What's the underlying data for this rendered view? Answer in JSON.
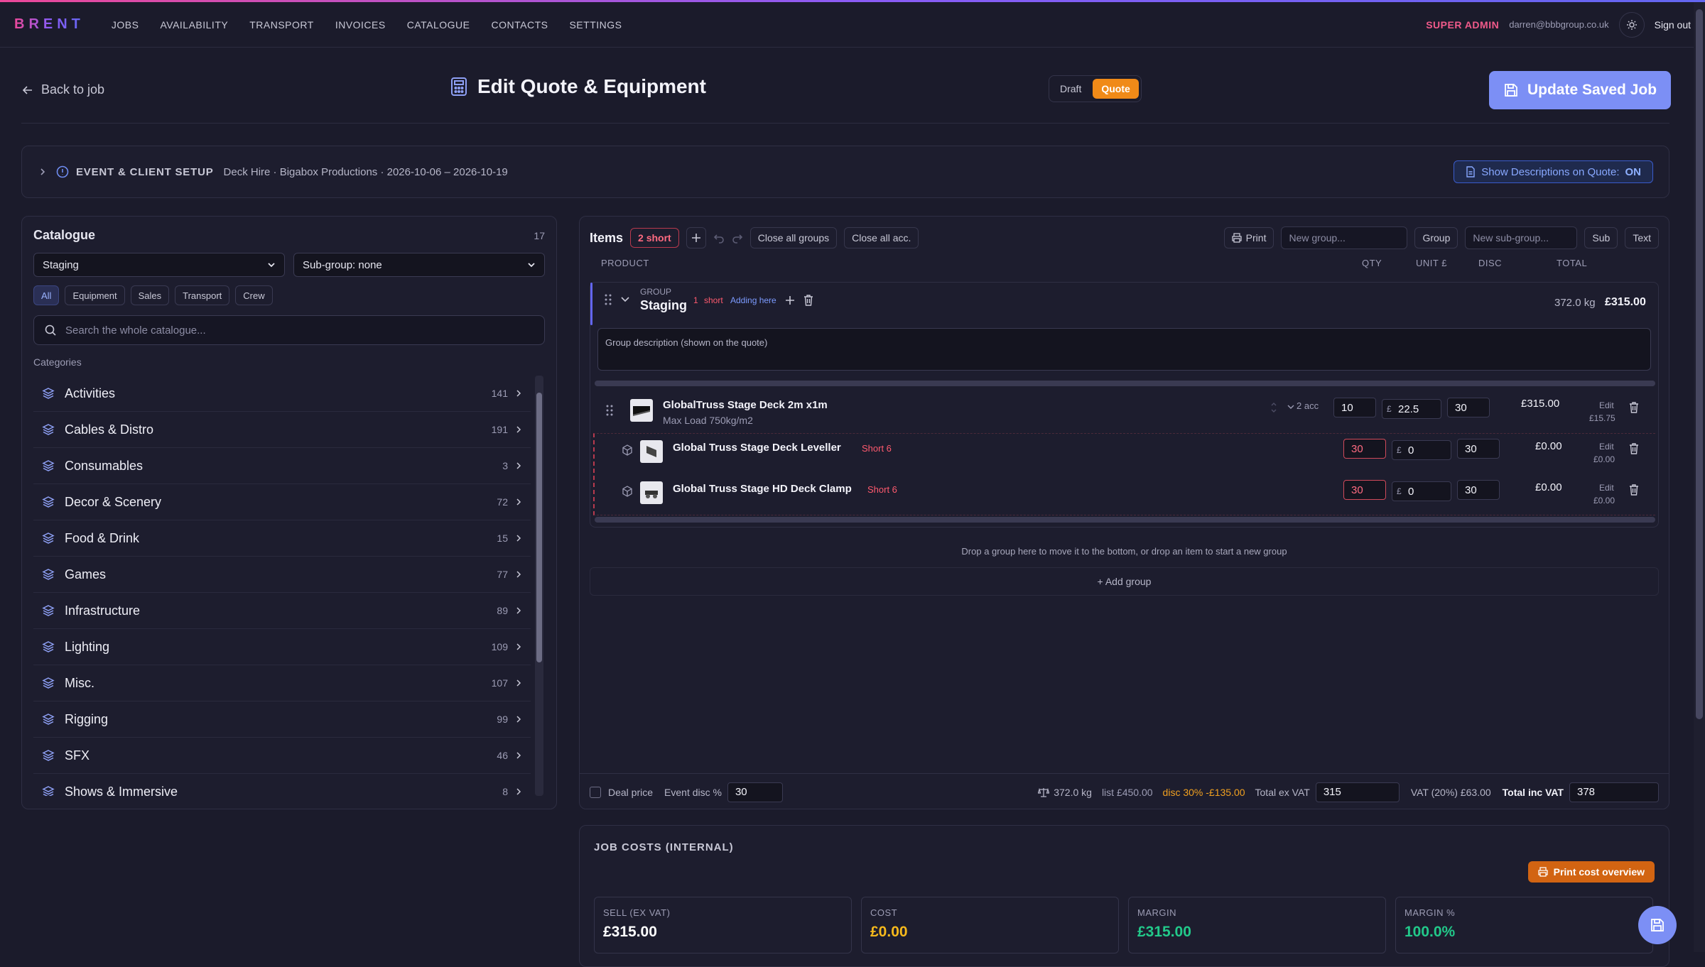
{
  "nav": {
    "brand": "BRENT",
    "links": [
      "JOBS",
      "AVAILABILITY",
      "TRANSPORT",
      "INVOICES",
      "CATALOGUE",
      "CONTACTS",
      "SETTINGS"
    ],
    "role": "SUPER ADMIN",
    "email": "darren@bbbgroup.co.uk",
    "sign_out": "Sign out"
  },
  "header": {
    "back": "Back to job",
    "title": "Edit Quote & Equipment",
    "toggle": [
      "Draft",
      "Quote"
    ],
    "toggle_active": "Quote",
    "update": "Update Saved Job"
  },
  "setup": {
    "label": "EVENT & CLIENT SETUP",
    "summary": "Deck Hire · Bigabox Productions · 2026-10-06 – 2026-10-19",
    "desc_button": "Show Descriptions on Quote:",
    "desc_state": "ON"
  },
  "catalogue": {
    "title": "Catalogue",
    "count": "17",
    "category_select": "Staging",
    "subgroup_select": "Sub-group: none",
    "filters": [
      "All",
      "Equipment",
      "Sales",
      "Transport",
      "Crew"
    ],
    "search_placeholder": "Search the whole catalogue...",
    "categories_label": "Categories",
    "categories": [
      {
        "name": "Activities",
        "count": "141"
      },
      {
        "name": "Cables & Distro",
        "count": "191"
      },
      {
        "name": "Consumables",
        "count": "3"
      },
      {
        "name": "Decor & Scenery",
        "count": "72"
      },
      {
        "name": "Food & Drink",
        "count": "15"
      },
      {
        "name": "Games",
        "count": "77"
      },
      {
        "name": "Infrastructure",
        "count": "89"
      },
      {
        "name": "Lighting",
        "count": "109"
      },
      {
        "name": "Misc.",
        "count": "107"
      },
      {
        "name": "Rigging",
        "count": "99"
      },
      {
        "name": "SFX",
        "count": "46"
      },
      {
        "name": "Shows & Immersive",
        "count": "8"
      }
    ]
  },
  "items": {
    "title": "Items",
    "short_badge": "2 short",
    "close_groups": "Close all groups",
    "close_acc": "Close all acc.",
    "print": "Print",
    "new_group_placeholder": "New group...",
    "group_btn": "Group",
    "new_sub_placeholder": "New sub-group...",
    "sub_btn": "Sub",
    "text_btn": "Text",
    "columns": {
      "product": "PRODUCT",
      "qty": "QTY",
      "unit": "UNIT £",
      "disc": "DISC",
      "total": "TOTAL"
    },
    "group": {
      "label": "GROUP",
      "name": "Staging",
      "short_count": "1",
      "short_word": "short",
      "adding": "Adding here",
      "weight": "372.0 kg",
      "total": "£315.00",
      "desc_placeholder": "Group description (shown on the quote)"
    },
    "lines": [
      {
        "name": "GlobalTruss Stage Deck 2m x1m",
        "sub": "Max Load 750kg/m2",
        "acc": "2 acc",
        "qty": "10",
        "unit": "22.5",
        "disc": "30",
        "total": "£315.00",
        "edit": "Edit",
        "net": "£15.75",
        "short": ""
      },
      {
        "name": "Global Truss Stage Deck Leveller",
        "sub": "",
        "acc": "",
        "qty": "30",
        "unit": "0",
        "disc": "30",
        "total": "£0.00",
        "edit": "Edit",
        "net": "£0.00",
        "short": "Short 6"
      },
      {
        "name": "Global Truss Stage HD Deck Clamp",
        "sub": "",
        "acc": "",
        "qty": "30",
        "unit": "0",
        "disc": "30",
        "total": "£0.00",
        "edit": "Edit",
        "net": "£0.00",
        "short": "Short 6"
      }
    ],
    "currency": "£",
    "drop_note": "Drop a group here to move it to the bottom, or drop an item to start a new group",
    "add_group": "+ Add group",
    "footer": {
      "deal": "Deal price",
      "event_disc_label": "Event disc %",
      "event_disc": "30",
      "weight": "372.0 kg",
      "list": "list £450.00",
      "disc": "disc 30% -£135.00",
      "ex_vat_label": "Total ex VAT",
      "ex_vat": "315",
      "vat": "VAT (20%) £63.00",
      "inc_vat_label": "Total inc VAT",
      "inc_vat": "378"
    }
  },
  "costs": {
    "title": "JOB COSTS (INTERNAL)",
    "print": "Print cost overview",
    "cards": [
      {
        "label": "SELL (EX VAT)",
        "value": "£315.00",
        "color": "#ffffff"
      },
      {
        "label": "COST",
        "value": "£0.00",
        "color": "#f6b91c"
      },
      {
        "label": "MARGIN",
        "value": "£315.00",
        "color": "#22c98a"
      },
      {
        "label": "MARGIN %",
        "value": "100.0%",
        "color": "#22c98a"
      }
    ]
  }
}
